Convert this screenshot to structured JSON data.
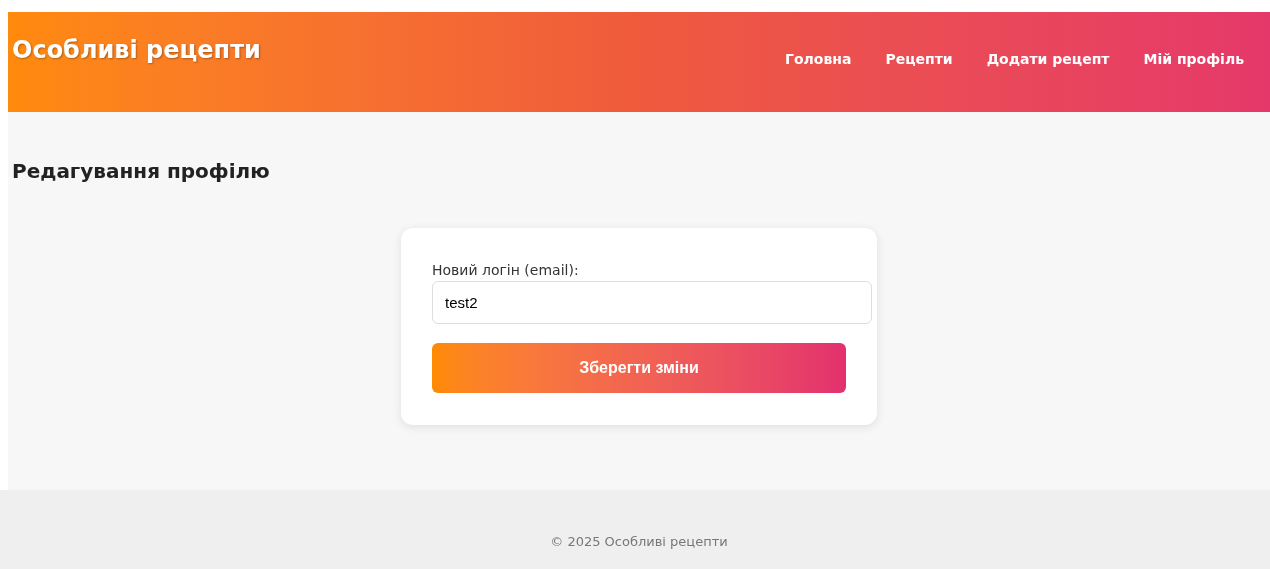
{
  "header": {
    "logo": "Особливі рецепти",
    "nav": [
      {
        "label": "Головна"
      },
      {
        "label": "Рецепти"
      },
      {
        "label": "Додати рецепт"
      },
      {
        "label": "Мій профіль"
      }
    ]
  },
  "page_title": "Редагування профілю",
  "form": {
    "label": "Новий логін (email):",
    "value": "test2",
    "button": "Зберегти зміни"
  },
  "footer": "© 2025 Особливі рецепти"
}
